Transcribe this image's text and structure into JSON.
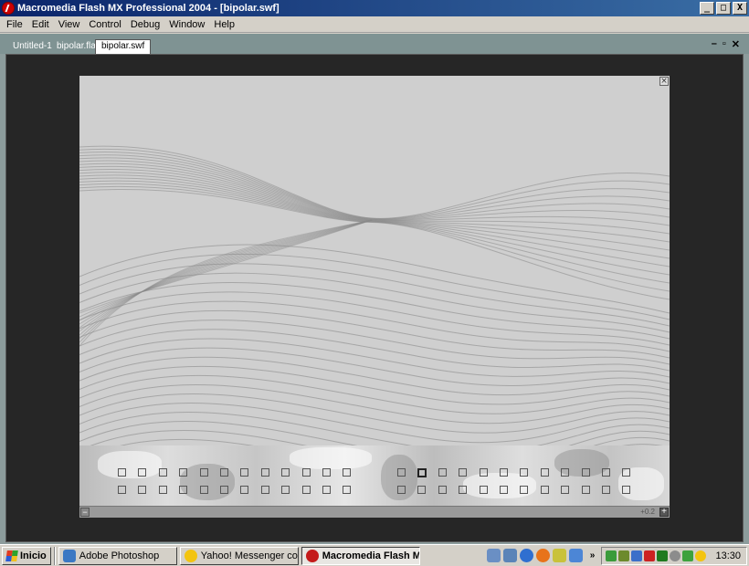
{
  "window": {
    "title": "Macromedia Flash MX Professional 2004 - [bipolar.swf]",
    "buttons": {
      "minimize": "_",
      "maximize": "□",
      "close": "X"
    }
  },
  "menu": [
    "File",
    "Edit",
    "View",
    "Control",
    "Debug",
    "Window",
    "Help"
  ],
  "tabs": [
    "Untitled-1",
    "bipolar.fla",
    "bipolar.swf"
  ],
  "active_tab": "bipolar.swf",
  "doc_controls": {
    "minimize": "–",
    "restore": "▫",
    "close": "✕"
  },
  "stage": {
    "close": "×",
    "zoom_value": "+0.2",
    "minus": "−",
    "plus": "+",
    "selected_square": "top row, square 15"
  },
  "taskbar": {
    "start": "Inicio",
    "tasks": [
      {
        "label": "Adobe Photoshop",
        "icon": "photoshop-icon",
        "color": "#3b78c3"
      },
      {
        "label": "Yahoo! Messenger con Voz",
        "icon": "yahoo-smiley-icon",
        "color": "#f3c40f"
      },
      {
        "label": "Macromedia Flash MX...",
        "icon": "flash-icon",
        "color": "#c41a1a"
      }
    ],
    "quick_chevron": "»",
    "clock": "13:30"
  },
  "colors": {
    "title_start": "#0a246a",
    "title_end": "#3a6ea5",
    "workspace": "#262626",
    "stage": "#cfcfcf"
  }
}
